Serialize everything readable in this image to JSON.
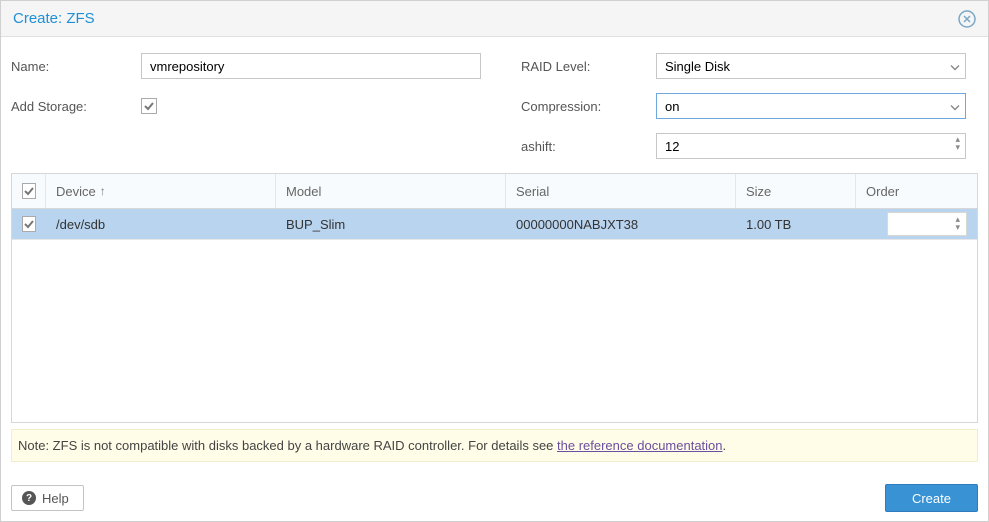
{
  "window": {
    "title": "Create: ZFS"
  },
  "form": {
    "name": {
      "label": "Name:",
      "value": "vmrepository"
    },
    "add_storage": {
      "label": "Add Storage:",
      "checked": true
    },
    "raid_level": {
      "label": "RAID Level:",
      "value": "Single Disk"
    },
    "compression": {
      "label": "Compression:",
      "value": "on"
    },
    "ashift": {
      "label": "ashift:",
      "value": "12"
    }
  },
  "grid": {
    "headers": {
      "device": "Device",
      "model": "Model",
      "serial": "Serial",
      "size": "Size",
      "order": "Order"
    },
    "sort_column": "device",
    "sort_dir": "asc",
    "rows": [
      {
        "checked": true,
        "device": "/dev/sdb",
        "model": "BUP_Slim",
        "serial": "00000000NABJXT38",
        "size": "1.00 TB",
        "order": ""
      }
    ]
  },
  "note": {
    "text_prefix": "Note: ZFS is not compatible with disks backed by a hardware RAID controller. For details see ",
    "link_text": "the reference documentation",
    "text_suffix": "."
  },
  "footer": {
    "help_label": "Help",
    "create_label": "Create"
  }
}
